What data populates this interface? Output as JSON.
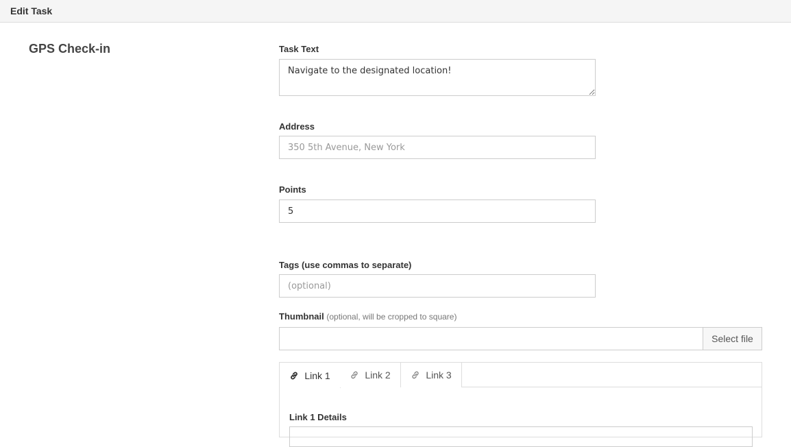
{
  "header": {
    "title": "Edit Task"
  },
  "task": {
    "type_title": "GPS Check-in"
  },
  "form": {
    "task_text": {
      "label": "Task Text",
      "value": "Navigate to the designated location!"
    },
    "address": {
      "label": "Address",
      "value": "",
      "placeholder": "350 5th Avenue, New York"
    },
    "points": {
      "label": "Points",
      "value": "5"
    },
    "tags": {
      "label": "Tags (use commas to separate)",
      "value": "",
      "placeholder": "(optional)"
    },
    "thumbnail": {
      "label": "Thumbnail",
      "hint": "(optional, will be cropped to square)",
      "button_label": "Select file"
    }
  },
  "links": {
    "tabs": [
      {
        "label": "Link 1",
        "icon": "link-icon",
        "active": true
      },
      {
        "label": "Link 2",
        "icon": "link-icon",
        "active": false
      },
      {
        "label": "Link 3",
        "icon": "link-icon",
        "active": false
      }
    ],
    "details_label": "Link 1 Details"
  }
}
